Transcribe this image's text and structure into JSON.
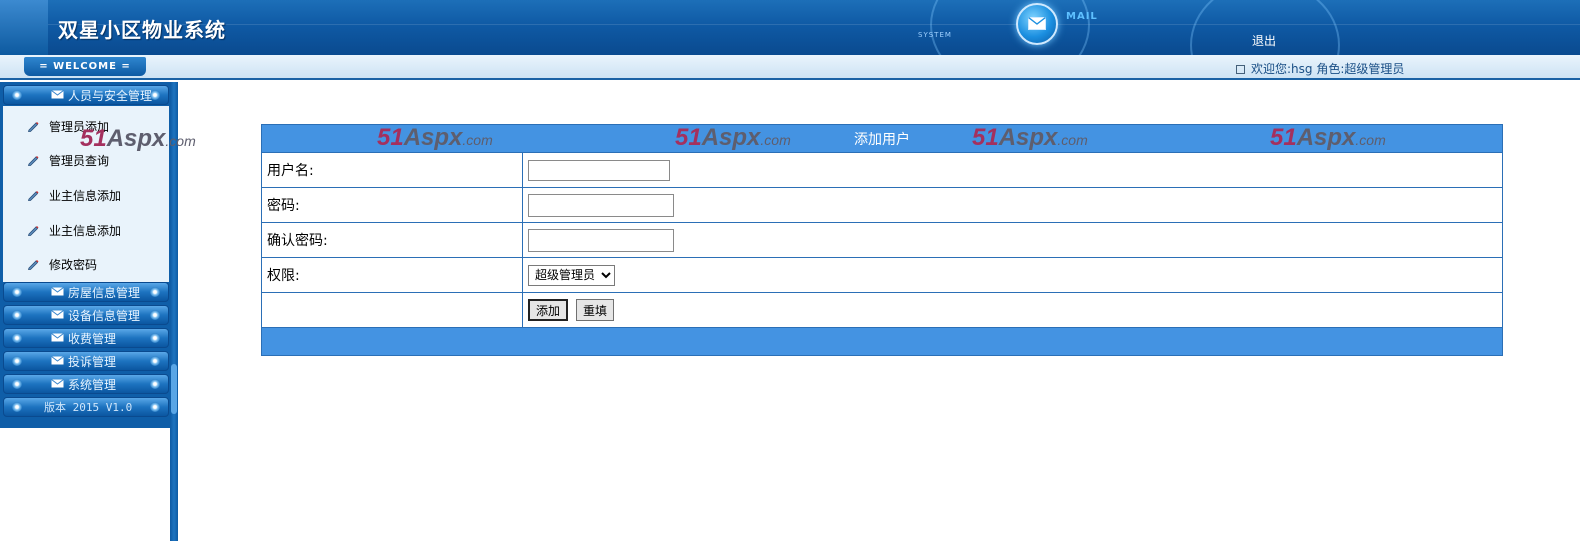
{
  "header": {
    "title": "双星小区物业系统",
    "system_text": "SYSTEM",
    "mail_text": "MAIL",
    "logout": "退出"
  },
  "welcome": {
    "tab_label": "= WELCOME =",
    "user_info": "欢迎您:hsg 角色:超级管理员"
  },
  "sidebar": {
    "groups": [
      {
        "label": "人员与安全管理"
      },
      {
        "label": "房屋信息管理"
      },
      {
        "label": "设备信息管理"
      },
      {
        "label": "收费管理"
      },
      {
        "label": "投诉管理"
      },
      {
        "label": "系统管理"
      }
    ],
    "subitems": [
      {
        "label": "管理员添加"
      },
      {
        "label": "管理员查询"
      },
      {
        "label": "业主信息添加"
      },
      {
        "label": "业主信息添加"
      },
      {
        "label": "修改密码"
      }
    ],
    "version": "版本 2015 V1.0"
  },
  "watermark": {
    "num": "51",
    "brand": "Aspx",
    "tld": ".com"
  },
  "form": {
    "title": "添加用户",
    "fields": {
      "username_label": "用户名:",
      "username_value": "",
      "password_label": "密码:",
      "password_value": "",
      "confirm_label": "确认密码:",
      "confirm_value": "",
      "role_label": "权限:",
      "role_selected": "超级管理员"
    },
    "buttons": {
      "add": "添加",
      "reset": "重填"
    }
  },
  "colors": {
    "header": "#0f5aa5",
    "table_border": "#2b6fb6",
    "table_header": "#4493e2"
  }
}
